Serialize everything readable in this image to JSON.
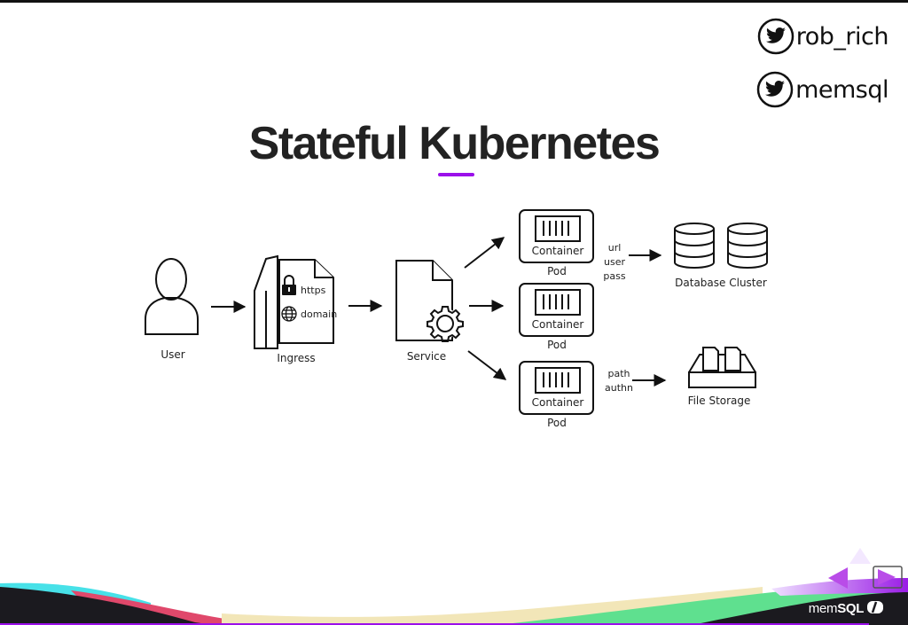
{
  "slide": {
    "title": "Stateful Kubernetes",
    "accent_color": "#9b10ea"
  },
  "social": [
    {
      "icon": "twitter-icon",
      "handle": "rob_rich"
    },
    {
      "icon": "twitter-icon",
      "handle": "memsql"
    }
  ],
  "diagram": {
    "user": {
      "label": "User"
    },
    "ingress": {
      "label": "Ingress",
      "features": [
        "https",
        "domain"
      ]
    },
    "service": {
      "label": "Service"
    },
    "pods": [
      {
        "label": "Pod",
        "inner": "Container"
      },
      {
        "label": "Pod",
        "inner": "Container"
      },
      {
        "label": "Pod",
        "inner": "Container"
      }
    ],
    "db_link": {
      "lines": [
        "url",
        "user",
        "pass"
      ]
    },
    "database": {
      "label": "Database Cluster"
    },
    "file_link": {
      "lines": [
        "path",
        "authn"
      ]
    },
    "file_storage": {
      "label": "File Storage"
    }
  },
  "footer": {
    "brand_light": "mem",
    "brand_bold": "SQL",
    "nav": {
      "prev": "previous-slide",
      "next": "next-slide",
      "up": "slide-overview"
    }
  }
}
